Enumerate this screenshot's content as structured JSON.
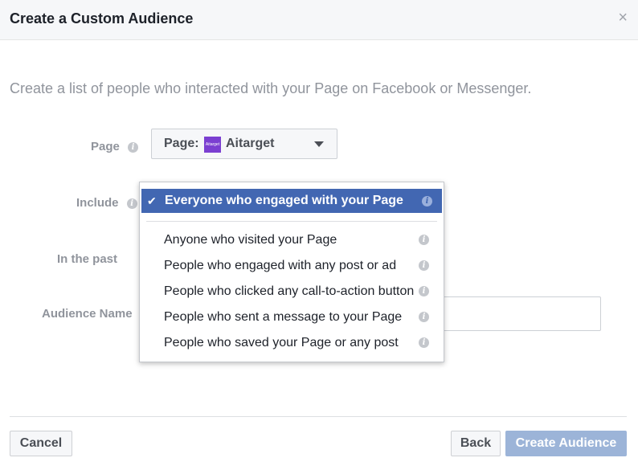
{
  "dialog": {
    "title": "Create a Custom Audience",
    "close_symbol": "×",
    "intro": "Create a list of people who interacted with your Page on Facebook or Messenger."
  },
  "form": {
    "page_label": "Page",
    "page_prefix": "Page:",
    "page_logo_text": "Aitarget",
    "page_name": "Aitarget",
    "include_label": "Include",
    "past_label": "In the past",
    "audience_name_label": "Audience Name",
    "info_symbol": "i"
  },
  "include_dropdown": {
    "selected": "Everyone who engaged with your Page",
    "check_symbol": "✔",
    "options": [
      "Anyone who visited your Page",
      "People who engaged with any post or ad",
      "People who clicked any call-to-action button",
      "People who sent a message to your Page",
      "People who saved your Page or any post"
    ]
  },
  "footer": {
    "cancel": "Cancel",
    "back": "Back",
    "create": "Create Audience"
  },
  "colors": {
    "accent": "#4267b2",
    "disabled_primary": "#9cb4d8",
    "header_bg": "#f6f7f9",
    "muted_text": "#90949c"
  },
  "icons": [
    "close-icon",
    "info-icon",
    "caret-down-icon",
    "checkmark-icon",
    "page-logo"
  ]
}
